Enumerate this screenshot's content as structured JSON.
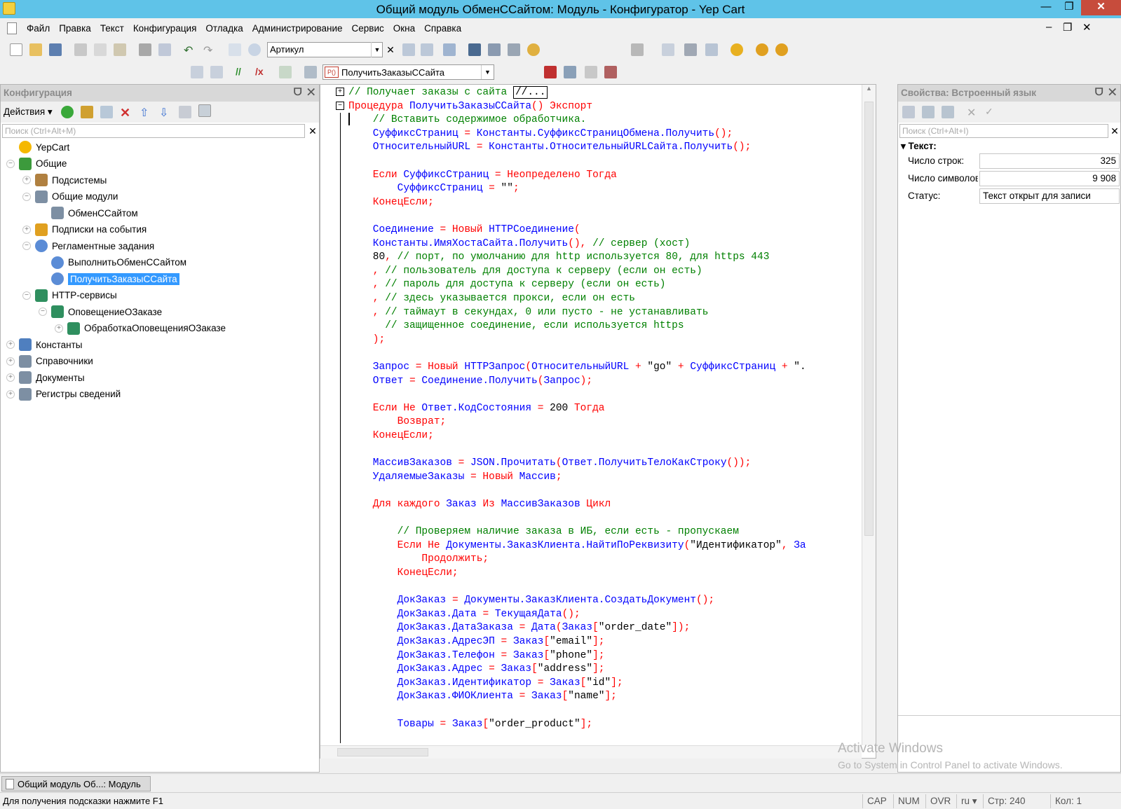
{
  "window": {
    "title": "Общий модуль ОбменССайтом: Модуль - Конфигуратор - Yep Cart",
    "minimize": "—",
    "maximize": "❐",
    "close": "✕"
  },
  "menu": {
    "items": [
      "Файл",
      "Правка",
      "Текст",
      "Конфигурация",
      "Отладка",
      "Администрирование",
      "Сервис",
      "Окна",
      "Справка"
    ],
    "min": "–",
    "restore": "❐",
    "close": "✕"
  },
  "toolbar": {
    "search_value": "Артикул",
    "procedure_value": "ПолучитьЗаказыССайта",
    "procedure_icon": "P()"
  },
  "config_panel": {
    "title": "Конфигурация",
    "actions_label": "Действия ▾",
    "search_placeholder": "Поиск (Ctrl+Alt+M)",
    "tree": [
      {
        "label": "YepCart",
        "icon": "yep-cart-icon",
        "color": "#f5b800",
        "expand": ""
      },
      {
        "label": "Общие",
        "icon": "common-icon",
        "color": "#3c9a3c",
        "expand": "−"
      },
      {
        "label": "Подсистемы",
        "icon": "subsystems-icon",
        "color": "#b08040",
        "expand": "+"
      },
      {
        "label": "Общие модули",
        "icon": "modules-icon",
        "color": "#7d8fa3",
        "expand": "−"
      },
      {
        "label": "ОбменССайтом",
        "icon": "module-icon",
        "color": "#7d8fa3",
        "expand": ""
      },
      {
        "label": "Подписки на события",
        "icon": "events-icon",
        "color": "#e0a020",
        "expand": "+"
      },
      {
        "label": "Регламентные задания",
        "icon": "scheduled-icon",
        "color": "#5b8cd6",
        "expand": "−"
      },
      {
        "label": "ВыполнитьОбменССайтом",
        "icon": "job-icon",
        "color": "#5b8cd6",
        "expand": ""
      },
      {
        "label": "ПолучитьЗаказыССайта",
        "icon": "job-icon",
        "color": "#5b8cd6",
        "expand": ""
      },
      {
        "label": "HTTP-сервисы",
        "icon": "http-icon",
        "color": "#2f8f5f",
        "expand": "−"
      },
      {
        "label": "ОповещениеОЗаказе",
        "icon": "http-icon",
        "color": "#2f8f5f",
        "expand": "−"
      },
      {
        "label": "ОбработкаОповещенияОЗаказе",
        "icon": "http-method-icon",
        "color": "#2f8f5f",
        "expand": "+"
      },
      {
        "label": "Константы",
        "icon": "constants-icon",
        "color": "#4f7fbf",
        "expand": "+"
      },
      {
        "label": "Справочники",
        "icon": "catalogs-icon",
        "color": "#7d8fa3",
        "expand": "+"
      },
      {
        "label": "Документы",
        "icon": "documents-icon",
        "color": "#7d8fa3",
        "expand": "+"
      },
      {
        "label": "Регистры сведений",
        "icon": "registers-icon",
        "color": "#7d8fa3",
        "expand": "+"
      }
    ]
  },
  "editor": {
    "lines": [
      [
        {
          "t": "// Получает заказы с сайта ",
          "c": "cmt"
        },
        {
          "t": "//...",
          "c": "box"
        }
      ],
      [
        {
          "t": "Процедура ",
          "c": "kw"
        },
        {
          "t": "ПолучитьЗаказыССайта",
          "c": "id"
        },
        {
          "t": "() ",
          "c": "kw"
        },
        {
          "t": "Экспорт",
          "c": "kw"
        }
      ],
      [
        {
          "t": "    // Вставить содержимое обработчика.",
          "c": "cmt"
        }
      ],
      [
        {
          "t": "    СуффиксСтраниц ",
          "c": "id"
        },
        {
          "t": "= ",
          "c": "kw"
        },
        {
          "t": "Константы.СуффиксСтраницОбмена.Получить",
          "c": "id"
        },
        {
          "t": "();",
          "c": "kw"
        }
      ],
      [
        {
          "t": "    ОтносительныйURL ",
          "c": "id"
        },
        {
          "t": "= ",
          "c": "kw"
        },
        {
          "t": "Константы.ОтносительныйURLСайта.Получить",
          "c": "id"
        },
        {
          "t": "();",
          "c": "kw"
        }
      ],
      [
        {
          "t": "",
          "c": "id"
        }
      ],
      [
        {
          "t": "    Если ",
          "c": "kw"
        },
        {
          "t": "СуффиксСтраниц ",
          "c": "id"
        },
        {
          "t": "= Неопределено Тогда",
          "c": "kw"
        }
      ],
      [
        {
          "t": "        СуффиксСтраниц ",
          "c": "id"
        },
        {
          "t": "= ",
          "c": "kw"
        },
        {
          "t": "\"\"",
          "c": "str"
        },
        {
          "t": ";",
          "c": "kw"
        }
      ],
      [
        {
          "t": "    КонецЕсли;",
          "c": "kw"
        }
      ],
      [
        {
          "t": "",
          "c": "id"
        }
      ],
      [
        {
          "t": "    Соединение ",
          "c": "id"
        },
        {
          "t": "= Новый ",
          "c": "kw"
        },
        {
          "t": "HTTPСоединение",
          "c": "id"
        },
        {
          "t": "(",
          "c": "kw"
        }
      ],
      [
        {
          "t": "    Константы.ИмяХостаСайта.Получить",
          "c": "id"
        },
        {
          "t": "(), ",
          "c": "kw"
        },
        {
          "t": "// сервер (хост)",
          "c": "cmt"
        }
      ],
      [
        {
          "t": "    80",
          "c": "num"
        },
        {
          "t": ", ",
          "c": "kw"
        },
        {
          "t": "// порт, по умолчанию для http используется 80, для https 443",
          "c": "cmt"
        }
      ],
      [
        {
          "t": "    , ",
          "c": "kw"
        },
        {
          "t": "// пользователь для доступа к серверу (если он есть)",
          "c": "cmt"
        }
      ],
      [
        {
          "t": "    , ",
          "c": "kw"
        },
        {
          "t": "// пароль для доступа к серверу (если он есть)",
          "c": "cmt"
        }
      ],
      [
        {
          "t": "    , ",
          "c": "kw"
        },
        {
          "t": "// здесь указывается прокси, если он есть",
          "c": "cmt"
        }
      ],
      [
        {
          "t": "    , ",
          "c": "kw"
        },
        {
          "t": "// таймаут в секундах, 0 или пусто - не устанавливать",
          "c": "cmt"
        }
      ],
      [
        {
          "t": "      // защищенное соединение, если используется https",
          "c": "cmt"
        }
      ],
      [
        {
          "t": "    );",
          "c": "kw"
        }
      ],
      [
        {
          "t": "",
          "c": "id"
        }
      ],
      [
        {
          "t": "    Запрос ",
          "c": "id"
        },
        {
          "t": "= Новый ",
          "c": "kw"
        },
        {
          "t": "HTTPЗапрос",
          "c": "id"
        },
        {
          "t": "(",
          "c": "kw"
        },
        {
          "t": "ОтносительныйURL ",
          "c": "id"
        },
        {
          "t": "+ ",
          "c": "kw"
        },
        {
          "t": "\"go\" ",
          "c": "str"
        },
        {
          "t": "+ ",
          "c": "kw"
        },
        {
          "t": "СуффиксСтраниц ",
          "c": "id"
        },
        {
          "t": "+ ",
          "c": "kw"
        },
        {
          "t": "\".",
          "c": "str"
        }
      ],
      [
        {
          "t": "    Ответ ",
          "c": "id"
        },
        {
          "t": "= ",
          "c": "kw"
        },
        {
          "t": "Соединение.Получить",
          "c": "id"
        },
        {
          "t": "(",
          "c": "kw"
        },
        {
          "t": "Запрос",
          "c": "id"
        },
        {
          "t": ");",
          "c": "kw"
        }
      ],
      [
        {
          "t": "",
          "c": "id"
        }
      ],
      [
        {
          "t": "    Если Не ",
          "c": "kw"
        },
        {
          "t": "Ответ.КодСостояния ",
          "c": "id"
        },
        {
          "t": "= ",
          "c": "kw"
        },
        {
          "t": "200 ",
          "c": "num"
        },
        {
          "t": "Тогда",
          "c": "kw"
        }
      ],
      [
        {
          "t": "        Возврат;",
          "c": "kw"
        }
      ],
      [
        {
          "t": "    КонецЕсли;",
          "c": "kw"
        }
      ],
      [
        {
          "t": "",
          "c": "id"
        }
      ],
      [
        {
          "t": "    МассивЗаказов ",
          "c": "id"
        },
        {
          "t": "= ",
          "c": "kw"
        },
        {
          "t": "JSON.Прочитать",
          "c": "id"
        },
        {
          "t": "(",
          "c": "kw"
        },
        {
          "t": "Ответ.ПолучитьТелоКакСтроку",
          "c": "id"
        },
        {
          "t": "());",
          "c": "kw"
        }
      ],
      [
        {
          "t": "    УдаляемыеЗаказы ",
          "c": "id"
        },
        {
          "t": "= Новый ",
          "c": "kw"
        },
        {
          "t": "Массив",
          "c": "id"
        },
        {
          "t": ";",
          "c": "kw"
        }
      ],
      [
        {
          "t": "",
          "c": "id"
        }
      ],
      [
        {
          "t": "    Для каждого ",
          "c": "kw"
        },
        {
          "t": "Заказ ",
          "c": "id"
        },
        {
          "t": "Из ",
          "c": "kw"
        },
        {
          "t": "МассивЗаказов ",
          "c": "id"
        },
        {
          "t": "Цикл",
          "c": "kw"
        }
      ],
      [
        {
          "t": "",
          "c": "id"
        }
      ],
      [
        {
          "t": "        // Проверяем наличие заказа в ИБ, если есть - пропускаем",
          "c": "cmt"
        }
      ],
      [
        {
          "t": "        Если Не ",
          "c": "kw"
        },
        {
          "t": "Документы.ЗаказКлиента.НайтиПоРеквизиту",
          "c": "id"
        },
        {
          "t": "(",
          "c": "kw"
        },
        {
          "t": "\"Идентификатор\"",
          "c": "str"
        },
        {
          "t": ", ",
          "c": "kw"
        },
        {
          "t": "За",
          "c": "id"
        }
      ],
      [
        {
          "t": "            Продолжить;",
          "c": "kw"
        }
      ],
      [
        {
          "t": "        КонецЕсли;",
          "c": "kw"
        }
      ],
      [
        {
          "t": "",
          "c": "id"
        }
      ],
      [
        {
          "t": "        ДокЗаказ ",
          "c": "id"
        },
        {
          "t": "= ",
          "c": "kw"
        },
        {
          "t": "Документы.ЗаказКлиента.СоздатьДокумент",
          "c": "id"
        },
        {
          "t": "();",
          "c": "kw"
        }
      ],
      [
        {
          "t": "        ДокЗаказ.Дата ",
          "c": "id"
        },
        {
          "t": "= ",
          "c": "kw"
        },
        {
          "t": "ТекущаяДата",
          "c": "id"
        },
        {
          "t": "();",
          "c": "kw"
        }
      ],
      [
        {
          "t": "        ДокЗаказ.ДатаЗаказа ",
          "c": "id"
        },
        {
          "t": "= ",
          "c": "kw"
        },
        {
          "t": "Дата",
          "c": "id"
        },
        {
          "t": "(",
          "c": "kw"
        },
        {
          "t": "Заказ",
          "c": "id"
        },
        {
          "t": "[",
          "c": "kw"
        },
        {
          "t": "\"order_date\"",
          "c": "str"
        },
        {
          "t": "]);",
          "c": "kw"
        }
      ],
      [
        {
          "t": "        ДокЗаказ.АдресЭП ",
          "c": "id"
        },
        {
          "t": "= ",
          "c": "kw"
        },
        {
          "t": "Заказ",
          "c": "id"
        },
        {
          "t": "[",
          "c": "kw"
        },
        {
          "t": "\"email\"",
          "c": "str"
        },
        {
          "t": "];",
          "c": "kw"
        }
      ],
      [
        {
          "t": "        ДокЗаказ.Телефон ",
          "c": "id"
        },
        {
          "t": "= ",
          "c": "kw"
        },
        {
          "t": "Заказ",
          "c": "id"
        },
        {
          "t": "[",
          "c": "kw"
        },
        {
          "t": "\"phone\"",
          "c": "str"
        },
        {
          "t": "];",
          "c": "kw"
        }
      ],
      [
        {
          "t": "        ДокЗаказ.Адрес ",
          "c": "id"
        },
        {
          "t": "= ",
          "c": "kw"
        },
        {
          "t": "Заказ",
          "c": "id"
        },
        {
          "t": "[",
          "c": "kw"
        },
        {
          "t": "\"address\"",
          "c": "str"
        },
        {
          "t": "];",
          "c": "kw"
        }
      ],
      [
        {
          "t": "        ДокЗаказ.Идентификатор ",
          "c": "id"
        },
        {
          "t": "= ",
          "c": "kw"
        },
        {
          "t": "Заказ",
          "c": "id"
        },
        {
          "t": "[",
          "c": "kw"
        },
        {
          "t": "\"id\"",
          "c": "str"
        },
        {
          "t": "];",
          "c": "kw"
        }
      ],
      [
        {
          "t": "        ДокЗаказ.ФИОКлиента ",
          "c": "id"
        },
        {
          "t": "= ",
          "c": "kw"
        },
        {
          "t": "Заказ",
          "c": "id"
        },
        {
          "t": "[",
          "c": "kw"
        },
        {
          "t": "\"name\"",
          "c": "str"
        },
        {
          "t": "];",
          "c": "kw"
        }
      ],
      [
        {
          "t": "",
          "c": "id"
        }
      ],
      [
        {
          "t": "        Товары ",
          "c": "id"
        },
        {
          "t": "= ",
          "c": "kw"
        },
        {
          "t": "Заказ",
          "c": "id"
        },
        {
          "t": "[",
          "c": "kw"
        },
        {
          "t": "\"order_product\"",
          "c": "str"
        },
        {
          "t": "];",
          "c": "kw"
        }
      ]
    ]
  },
  "properties": {
    "title": "Свойства: Встроенный язык",
    "search_placeholder": "Поиск (Ctrl+Alt+I)",
    "group": "▾ Текст:",
    "rows": [
      {
        "label": "Число строк:",
        "value": "325",
        "align": "right"
      },
      {
        "label": "Число символов:",
        "value": "9 908",
        "align": "right"
      },
      {
        "label": "Статус:",
        "value": "Текст открыт для записи",
        "align": "left"
      }
    ]
  },
  "windows_bar": {
    "tab_label": "Общий модуль Об...: Модуль"
  },
  "status": {
    "hint": "Для получения подсказки нажмите F1",
    "cap": "CAP",
    "num": "NUM",
    "ovr": "OVR",
    "lang": "ru ▾",
    "line": "Стр: 240",
    "col": "Кол: 1"
  },
  "watermark": {
    "title": "Activate Windows",
    "subtitle": "Go to System in Control Panel to activate Windows."
  }
}
